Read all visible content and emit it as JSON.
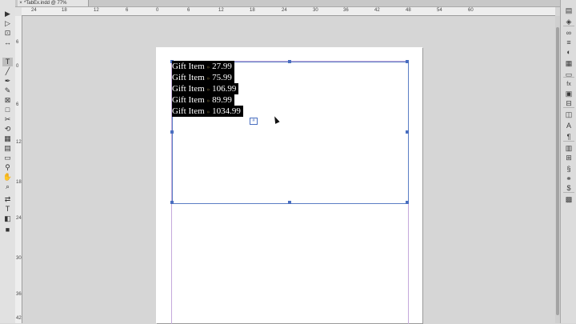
{
  "document": {
    "tab_label": "*TabEx.indd @ 77%",
    "close_glyph": "×"
  },
  "ruler": {
    "h_labels": [
      "24",
      "18",
      "12",
      "6",
      "0",
      "6",
      "12",
      "18",
      "24",
      "30",
      "36",
      "42",
      "48",
      "54",
      "60"
    ],
    "v_labels": [
      "6",
      "0",
      "6",
      "12",
      "18",
      "24",
      "30",
      "36",
      "42"
    ]
  },
  "text_frame": {
    "lines": [
      {
        "item": "Gift Item",
        "price": "27.99"
      },
      {
        "item": "Gift Item",
        "price": "75.99"
      },
      {
        "item": "Gift Item",
        "price": "106.99"
      },
      {
        "item": "Gift Item",
        "price": "89.99"
      },
      {
        "item": "Gift Item",
        "price": "1034.99"
      }
    ],
    "tab_glyph": "»",
    "overset_glyph": "#"
  },
  "tools": [
    {
      "name": "selection-tool-icon",
      "glyph": "▶"
    },
    {
      "name": "direct-selection-tool-icon",
      "glyph": "▷"
    },
    {
      "name": "page-tool-icon",
      "glyph": "⊡"
    },
    {
      "name": "gap-tool-icon",
      "glyph": "↔"
    },
    {
      "name": "type-tool-icon",
      "glyph": "T"
    },
    {
      "name": "line-tool-icon",
      "glyph": "╱"
    },
    {
      "name": "pen-tool-icon",
      "glyph": "✒"
    },
    {
      "name": "pencil-tool-icon",
      "glyph": "✎"
    },
    {
      "name": "rectangle-frame-tool-icon",
      "glyph": "⊠"
    },
    {
      "name": "rectangle-tool-icon",
      "glyph": "□"
    },
    {
      "name": "scissors-tool-icon",
      "glyph": "✂"
    },
    {
      "name": "free-transform-tool-icon",
      "glyph": "⟲"
    },
    {
      "name": "gradient-swatch-tool-icon",
      "glyph": "▦"
    },
    {
      "name": "gradient-feather-tool-icon",
      "glyph": "▤"
    },
    {
      "name": "note-tool-icon",
      "glyph": "▭"
    },
    {
      "name": "eyedropper-tool-icon",
      "glyph": "⚲"
    },
    {
      "name": "hand-tool-icon",
      "glyph": "✋"
    },
    {
      "name": "zoom-tool-icon",
      "glyph": "⌕"
    },
    {
      "name": "swap-fill-stroke-icon",
      "glyph": "⇄"
    },
    {
      "name": "formatting-text-icon",
      "glyph": "T"
    },
    {
      "name": "apply-none-icon",
      "glyph": "◧"
    },
    {
      "name": "screen-mode-icon",
      "glyph": "■"
    }
  ],
  "panels": [
    {
      "name": "pages-panel-icon",
      "glyph": "▤"
    },
    {
      "name": "layers-panel-icon",
      "glyph": "◈"
    },
    {
      "name": "links-panel-icon",
      "glyph": "∞"
    },
    {
      "name": "stroke-panel-icon",
      "glyph": "≡"
    },
    {
      "name": "color-panel-icon",
      "glyph": "◐"
    },
    {
      "name": "swatches-panel-icon",
      "glyph": "▦"
    },
    {
      "name": "gradient-panel-icon",
      "glyph": "▭"
    },
    {
      "name": "effects-panel-icon",
      "glyph": "fx"
    },
    {
      "name": "text-wrap-panel-icon",
      "glyph": "▣"
    },
    {
      "name": "align-panel-icon",
      "glyph": "⊟"
    },
    {
      "name": "pathfinder-panel-icon",
      "glyph": "◫"
    },
    {
      "name": "character-styles-panel-icon",
      "glyph": "A"
    },
    {
      "name": "paragraph-styles-panel-icon",
      "glyph": "¶"
    },
    {
      "name": "object-styles-panel-icon",
      "glyph": "▥"
    },
    {
      "name": "table-panel-icon",
      "glyph": "⊞"
    },
    {
      "name": "glyphs-panel-icon",
      "glyph": "§"
    },
    {
      "name": "hyperlinks-panel-icon",
      "glyph": "⚭"
    },
    {
      "name": "cc-libraries-panel-icon",
      "glyph": "$"
    },
    {
      "name": "cc-assets-panel-icon",
      "glyph": "▩"
    }
  ]
}
